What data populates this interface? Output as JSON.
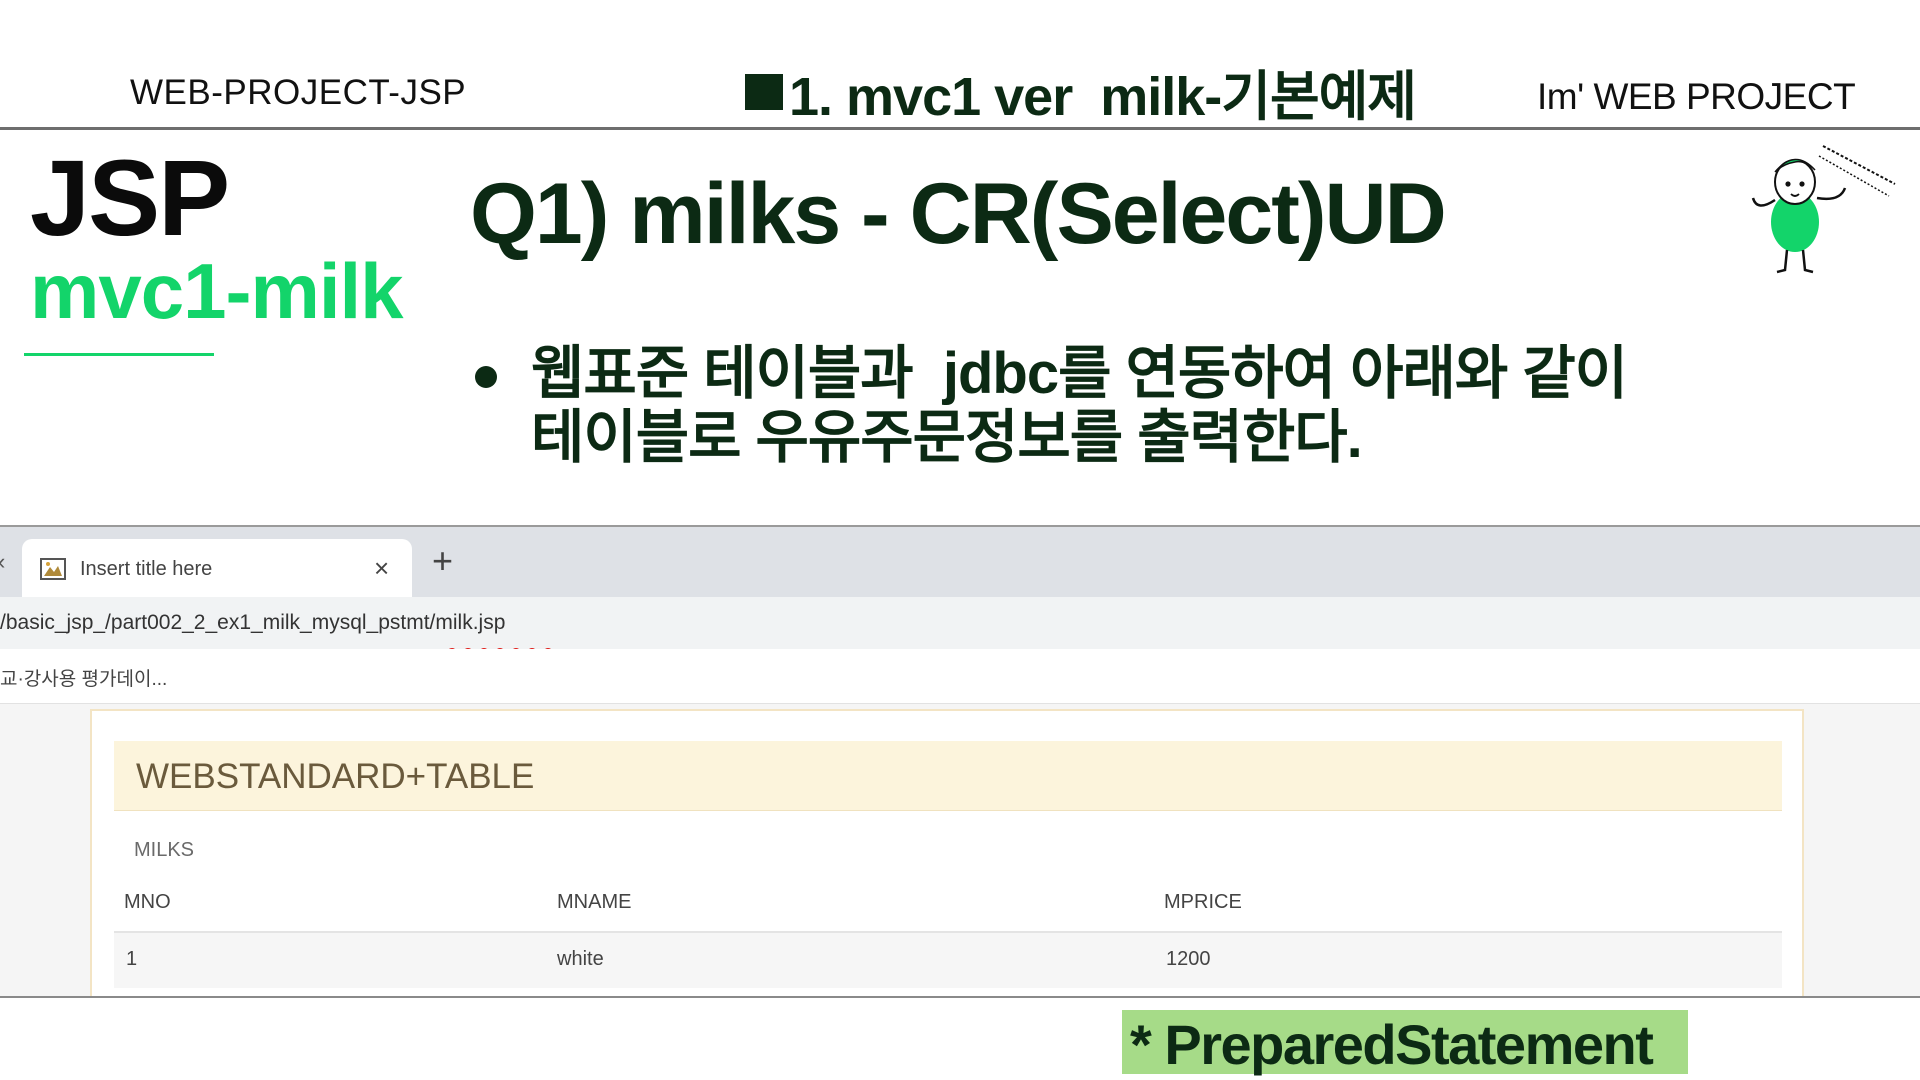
{
  "slide": {
    "header_left": "WEB-PROJECT-JSP",
    "header_center": "1. mvc1 ver  milk-기본예제",
    "header_right": "Im' WEB PROJECT",
    "main_title": "JSP",
    "sub_title": "mvc1-milk",
    "question": "Q1) milks - CR(Select)UD",
    "bullet_line1": "웹표준 테이블과  jdbc를 연동하여 아래와 같이",
    "bullet_line2": "테이블로 우유주문정보를 출력한다.",
    "bottom_note": "* PreparedStatement"
  },
  "browser": {
    "prev_tab_glyph": "‹",
    "tab_title": "Insert title here",
    "tab_close": "×",
    "new_tab": "+",
    "url": "/basic_jsp_/part002_2_ex1_milk_mysql_pstmt/milk.jsp",
    "bookmark": "교·강사용 평가데이..."
  },
  "webpage": {
    "banner": "WEBSTANDARD+TABLE",
    "caption": "MILKS",
    "columns": [
      "MNO",
      "MNAME",
      "MPRICE"
    ],
    "rows": [
      [
        "1",
        "white",
        "1200"
      ]
    ]
  },
  "colors": {
    "dark_green": "#0c2a14",
    "bright_green": "#13d46a",
    "highlight_green": "#a6db88",
    "banner_bg": "#fcf4dc"
  }
}
